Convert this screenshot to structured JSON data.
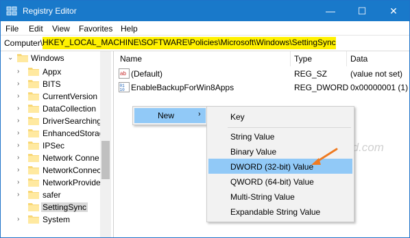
{
  "window": {
    "title": "Registry Editor",
    "buttons": {
      "minimize": "—",
      "maximize": "☐",
      "close": "✕"
    },
    "accent": "#1979ca"
  },
  "menu": [
    "File",
    "Edit",
    "View",
    "Favorites",
    "Help"
  ],
  "address": {
    "prefix": "Computer\\",
    "path": "HKEY_LOCAL_MACHINE\\SOFTWARE\\Policies\\Microsoft\\Windows\\SettingSync",
    "highlight": "#fff100"
  },
  "tree": {
    "parent": "Windows",
    "items": [
      "Appx",
      "BITS",
      "CurrentVersion",
      "DataCollection",
      "DriverSearching",
      "EnhancedStorag",
      "IPSec",
      "Network Conne",
      "NetworkConnec",
      "NetworkProvide",
      "safer",
      "SettingSync",
      "System"
    ],
    "selected": "SettingSync"
  },
  "list": {
    "columns": [
      "Name",
      "Type",
      "Data"
    ],
    "rows": [
      {
        "icon": "string-value-icon",
        "name": "(Default)",
        "type": "REG_SZ",
        "data": "(value not set)"
      },
      {
        "icon": "binary-value-icon",
        "name": "EnableBackupForWin8Apps",
        "type": "REG_DWORD",
        "data": "0x00000001 (1)"
      }
    ]
  },
  "context_menu": {
    "parent_item": "New",
    "submenu_arrow": "›",
    "items": [
      "Key",
      "String Value",
      "Binary Value",
      "DWORD (32-bit) Value",
      "QWORD (64-bit) Value",
      "Multi-String Value",
      "Expandable String Value"
    ],
    "highlighted": "DWORD (32-bit) Value"
  },
  "watermark": "top-password.com"
}
